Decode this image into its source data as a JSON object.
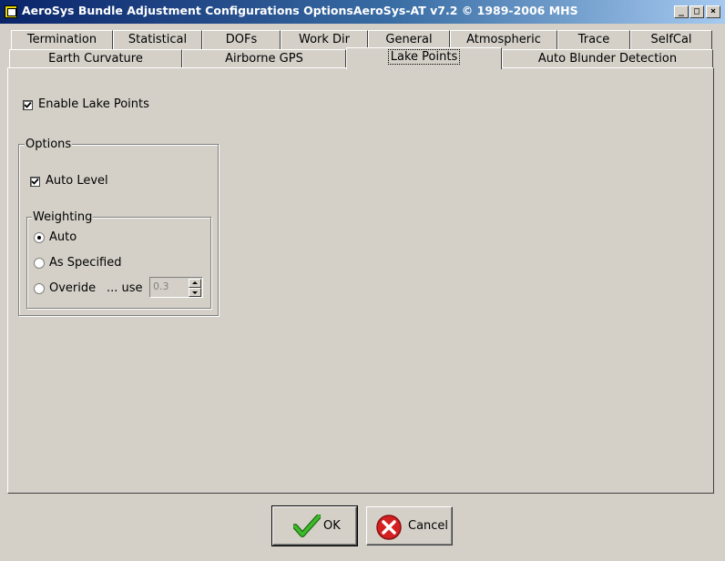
{
  "window": {
    "title": "AeroSys Bundle Adjustment Configurations OptionsAeroSys-AT  v7.2 © 1989-2006 MHS",
    "minimize_icon": "_",
    "maximize_icon": "□",
    "close_icon": "×"
  },
  "tabs": {
    "row1": [
      "Termination",
      "Statistical",
      "DOFs",
      "Work Dir",
      "General",
      "Atmospheric",
      "Trace",
      "SelfCal"
    ],
    "row2": [
      "Earth Curvature",
      "Airborne GPS",
      "Lake Points",
      "Auto Blunder Detection"
    ],
    "active": "Lake Points"
  },
  "lake_points": {
    "enable_label": "Enable Lake Points",
    "enable_checked": true,
    "options_group": "Options",
    "auto_level_label": "Auto Level",
    "auto_level_checked": true,
    "weighting_group": "Weighting",
    "weighting_options": [
      "Auto",
      "As Specified",
      "Overide"
    ],
    "weighting_selected": "Auto",
    "use_label": "... use",
    "use_value": "0.3"
  },
  "buttons": {
    "ok": "OK",
    "cancel": "Cancel"
  },
  "colors": {
    "face": "#d4d0c8",
    "title_start": "#0a246a",
    "title_end": "#a6caf0",
    "ok_check": "#2e9a1e",
    "cancel_circle": "#d42020"
  }
}
